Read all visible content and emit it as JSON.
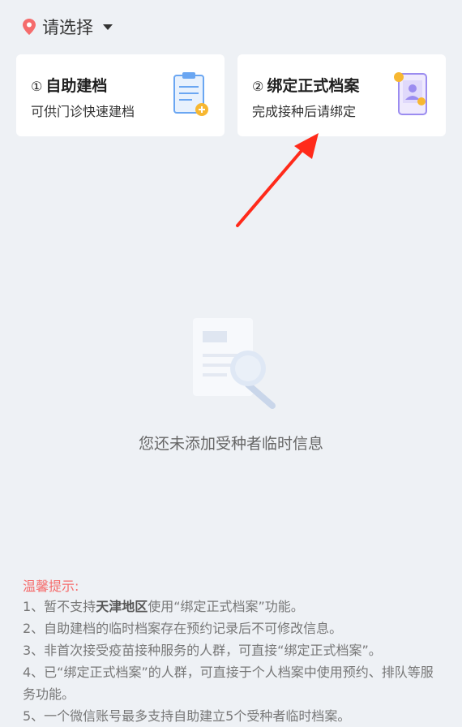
{
  "location": {
    "placeholder": "请选择"
  },
  "cards": [
    {
      "num": "①",
      "title": "自助建档",
      "subtitle": "可供门诊快速建档",
      "icon": "clipboard-add-icon"
    },
    {
      "num": "②",
      "title": "绑定正式档案",
      "subtitle": "完成接种后请绑定",
      "icon": "id-card-phone-icon"
    }
  ],
  "empty": {
    "text": "您还未添加受种者临时信息"
  },
  "tips": {
    "title": "温馨提示:",
    "line1_a": "1、暂不支持",
    "line1_b": "天津地区",
    "line1_c": "使用“绑定正式档案”功能。",
    "line2": "2、自助建档的临时档案存在预约记录后不可修改信息。",
    "line3": "3、非首次接受疫苗接种服务的人群，可直接“绑定正式档案”。",
    "line4": "4、已“绑定正式档案”的人群，可直接于个人档案中使用预约、排队等服务功能。",
    "line5": "5、一个微信账号最多支持自助建立5个受种者临时档案。"
  },
  "colors": {
    "accent": "#f56c6c",
    "arrow": "#ff2a1a",
    "background": "#eef1f5"
  }
}
